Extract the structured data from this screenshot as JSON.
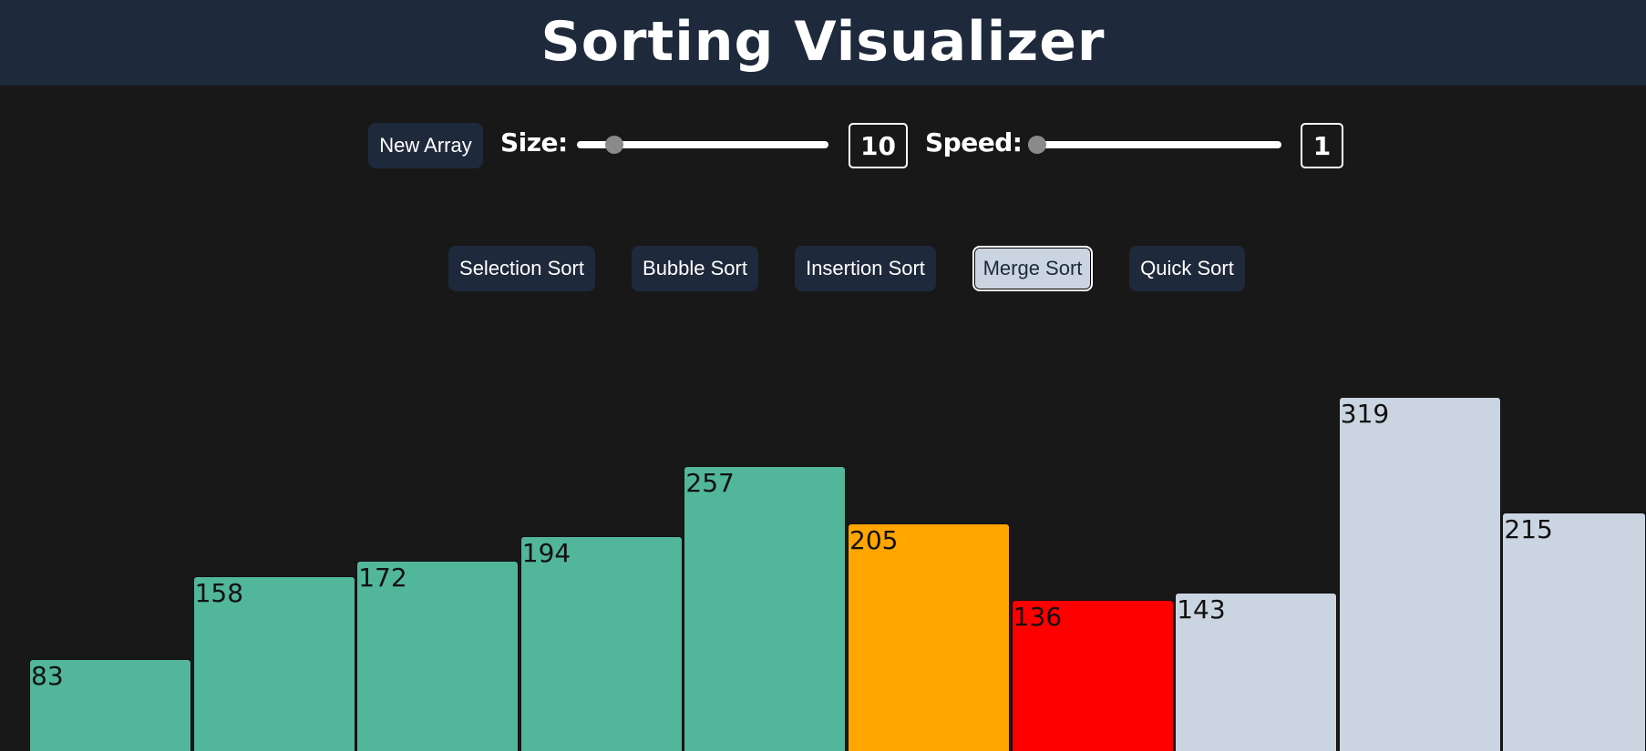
{
  "header": {
    "title": "Sorting Visualizer"
  },
  "controls": {
    "new_array_label": "New Array",
    "size_label": "Size:",
    "size_value": "10",
    "size_fraction": 0.12,
    "speed_label": "Speed:",
    "speed_value": "1",
    "speed_fraction": 0.0
  },
  "algorithms": [
    {
      "label": "Selection Sort",
      "active": false
    },
    {
      "label": "Bubble Sort",
      "active": false
    },
    {
      "label": "Insertion Sort",
      "active": false
    },
    {
      "label": "Merge Sort",
      "active": true
    },
    {
      "label": "Quick Sort",
      "active": false
    }
  ],
  "colors": {
    "header_bg": "#1e293b",
    "sorted": "#52b69a",
    "comparing": "#ffa500",
    "swapping": "#ff0000",
    "unsorted": "#cbd5e1"
  },
  "array": {
    "values": [
      83,
      158,
      172,
      194,
      257,
      205,
      136,
      143,
      319,
      215
    ],
    "states": [
      "sorted",
      "sorted",
      "sorted",
      "sorted",
      "sorted",
      "comparing",
      "swapping",
      "unsorted",
      "unsorted",
      "unsorted"
    ]
  }
}
